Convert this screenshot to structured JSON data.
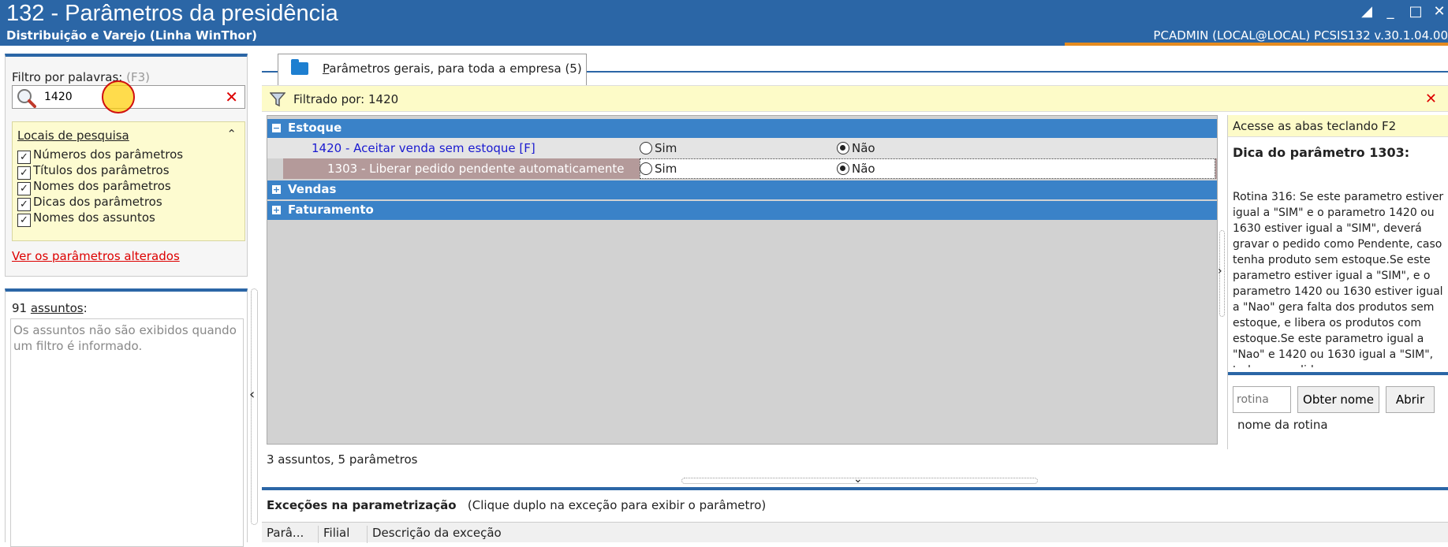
{
  "window": {
    "title": "132 - Parâmetros da presidência",
    "subtitle": "Distribuição e Varejo (Linha WinThor)",
    "user_info": "PCADMIN (LOCAL@LOCAL)   PCSIS132  v.30.1.04.00",
    "accent_color": "#2b66a6",
    "controls": [
      "restore-icon",
      "minimize-icon",
      "maximize-icon",
      "close-icon"
    ]
  },
  "filter": {
    "label": "Filtro por palavras:",
    "hotkey": "(F3)",
    "search_value": "1420",
    "locais": {
      "title": "Locais de pesquisa",
      "items": [
        {
          "label": "Números dos parâmetros",
          "checked": true
        },
        {
          "label": "Títulos dos parâmetros",
          "checked": true
        },
        {
          "label": "Nomes dos parâmetros",
          "checked": true
        },
        {
          "label": "Dicas dos parâmetros",
          "checked": true
        },
        {
          "label": "Nomes dos assuntos",
          "checked": true
        }
      ]
    },
    "changed_link": "Ver os parâmetros alterados"
  },
  "subjects": {
    "count_prefix": "91 ",
    "count_word": "assuntos",
    "count_suffix": ":",
    "message": "Os assuntos não são exibidos quando um filtro é informado."
  },
  "tab": {
    "label_prefix": "P",
    "label_rest": "arâmetros gerais, para toda a empresa",
    "count": "(5)"
  },
  "filter_banner": {
    "text": "Filtrado por: 1420"
  },
  "grid": {
    "groups": [
      {
        "title": "Estoque",
        "expanded": true,
        "rows": [
          {
            "title": "1420 - Aceitar venda sem estoque [F]",
            "yes": "Sim",
            "no": "Não",
            "value": "no",
            "title_color": "#1a1ad0"
          },
          {
            "title": "1303 - Liberar pedido pendente automaticamente",
            "yes": "Sim",
            "no": "Não",
            "value": "no",
            "title_color": "#ffffff"
          }
        ]
      },
      {
        "title": "Vendas",
        "expanded": false,
        "rows": []
      },
      {
        "title": "Faturamento",
        "expanded": false,
        "rows": []
      }
    ],
    "status": "3 assuntos, 5 parâmetros"
  },
  "tip": {
    "header": "Acesse as abas teclando F2",
    "title": "Dica do parâmetro 1303:",
    "text": "Rotina 316: Se este parametro estiver igual a \"SIM\" e o parametro 1420 ou 1630 estiver igual a \"SIM\", deverá gravar o pedido como Pendente, caso tenha produto sem estoque.Se este parametro estiver igual a \"SIM\", e o parametro 1420 ou 1630 estiver igual a \"Nao\" gera falta dos produtos sem estoque, e libera os produtos com estoque.Se este parametro igual a \"Nao\" e 1420 ou 1630 igual a \"SIM\", todos os pedidos",
    "rotina_placeholder": "rotina",
    "btn_obter": "Obter nome",
    "btn_abrir": "Abrir",
    "rotina_name": "nome da rotina"
  },
  "exceptions": {
    "title": "Exceções na parametrização",
    "hint": "(Clique duplo na exceção para exibir o parâmetro)",
    "columns": [
      "Parâ...",
      "Filial",
      "Descrição da exceção"
    ]
  }
}
